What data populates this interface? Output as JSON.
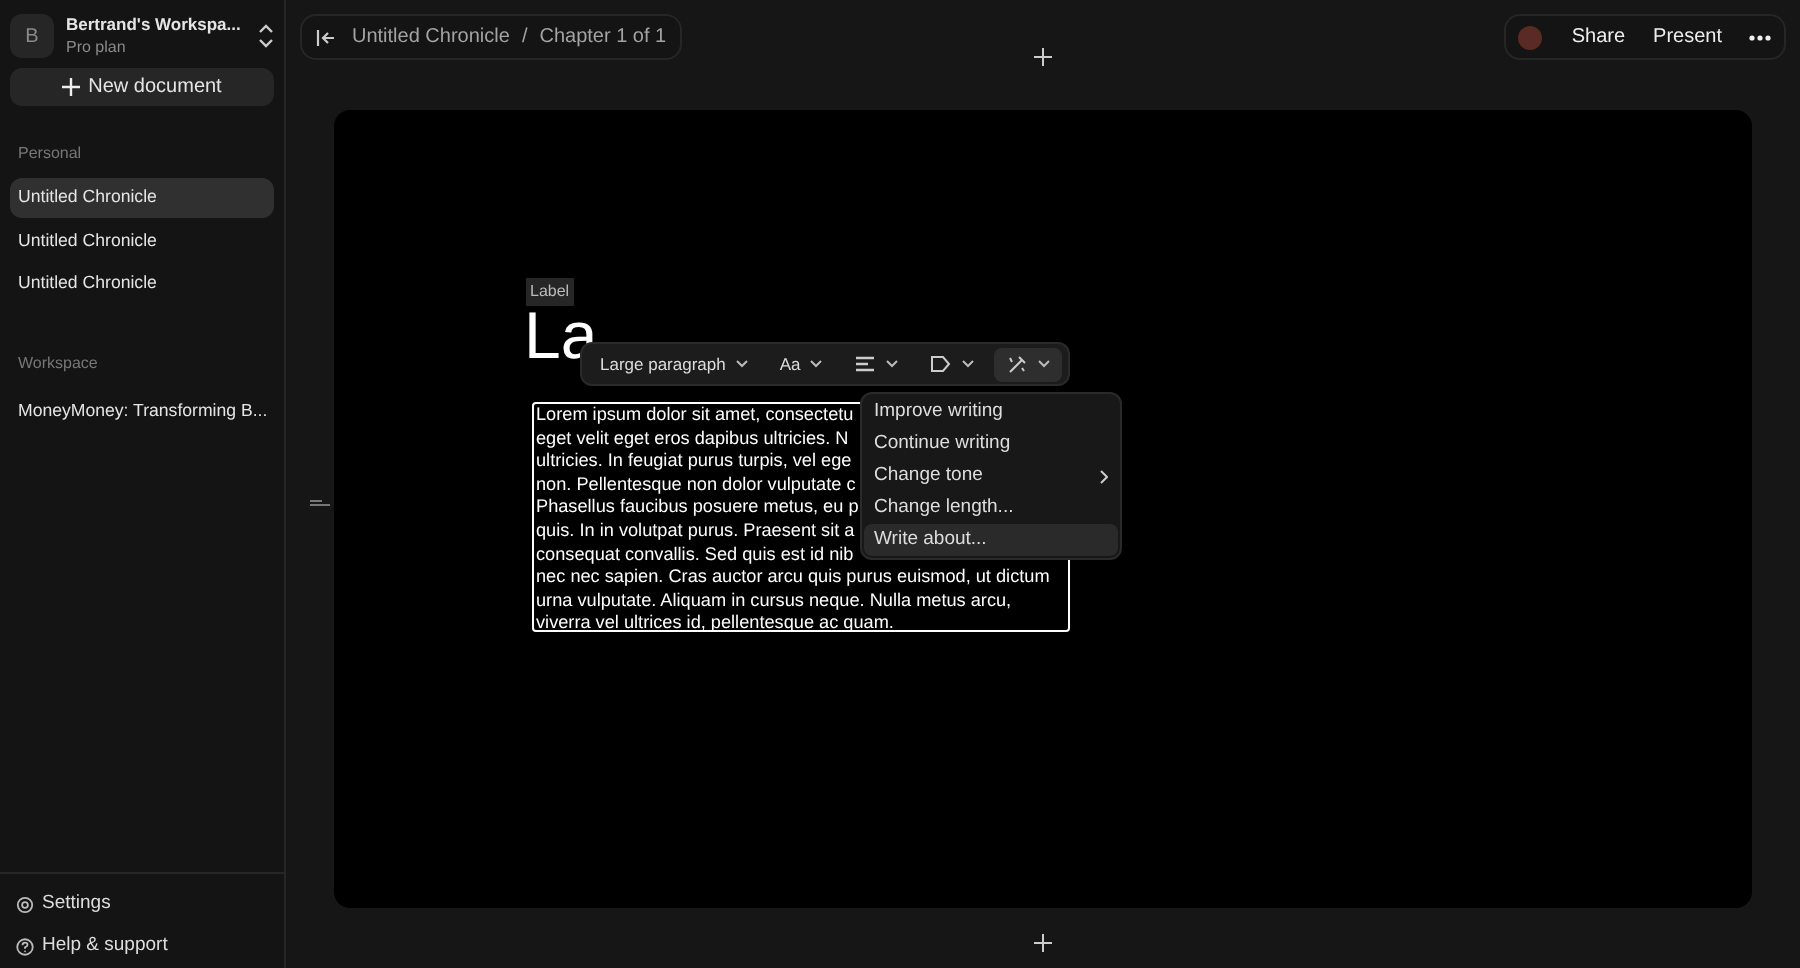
{
  "workspace": {
    "avatar": "B",
    "name": "Bertrand's Workspa...",
    "plan": "Pro plan"
  },
  "new_document": "New document",
  "sections": [
    {
      "title": "Personal",
      "items": [
        {
          "label": "Untitled Chronicle",
          "selected": true
        },
        {
          "label": "Untitled Chronicle",
          "selected": false
        },
        {
          "label": "Untitled Chronicle",
          "selected": false
        }
      ]
    },
    {
      "title": "Workspace",
      "items": [
        {
          "label": "MoneyMoney: Transforming B...",
          "selected": false
        }
      ]
    }
  ],
  "footer": [
    {
      "kind": "settings",
      "label": "Settings"
    },
    {
      "kind": "help",
      "label": "Help & support"
    }
  ],
  "breadcrumb": [
    "Untitled Chronicle",
    "/",
    "Chapter 1 of 1"
  ],
  "actions": [
    "Share",
    "Present"
  ],
  "document": {
    "label": "Label",
    "heading": "La",
    "paragraph_lines": [
      "Lorem ipsum dolor sit amet, consectetu",
      "eget velit eget eros dapibus ultricies. N",
      "ultricies. In feugiat purus turpis, vel ege",
      "non. Pellentesque non dolor vulputate c",
      "Phasellus faucibus posuere metus, eu p",
      "quis. In in volutpat purus. Praesent sit a",
      "consequat convallis. Sed quis est id nib",
      "nec nec sapien. Cras auctor arcu quis purus euismod, ut dictum",
      "urna vulputate. Aliquam in cursus neque. Nulla metus arcu,",
      "viverra vel ultrices id, pellentesque ac quam."
    ]
  },
  "toolbar": [
    {
      "kind": "style",
      "label": "Large paragraph",
      "selected": false
    },
    {
      "kind": "font",
      "label": "Aa",
      "selected": false
    },
    {
      "kind": "align",
      "selected": false
    },
    {
      "kind": "tag",
      "selected": false
    },
    {
      "kind": "ai",
      "selected": true
    }
  ],
  "menu": [
    {
      "label": "Improve writing",
      "submenu": false,
      "selected": false
    },
    {
      "label": "Continue writing",
      "submenu": false,
      "selected": false
    },
    {
      "label": "Change tone",
      "submenu": true,
      "selected": false
    },
    {
      "label": "Change length...",
      "submenu": false,
      "selected": false
    },
    {
      "label": "Write about...",
      "submenu": false,
      "selected": true
    }
  ]
}
